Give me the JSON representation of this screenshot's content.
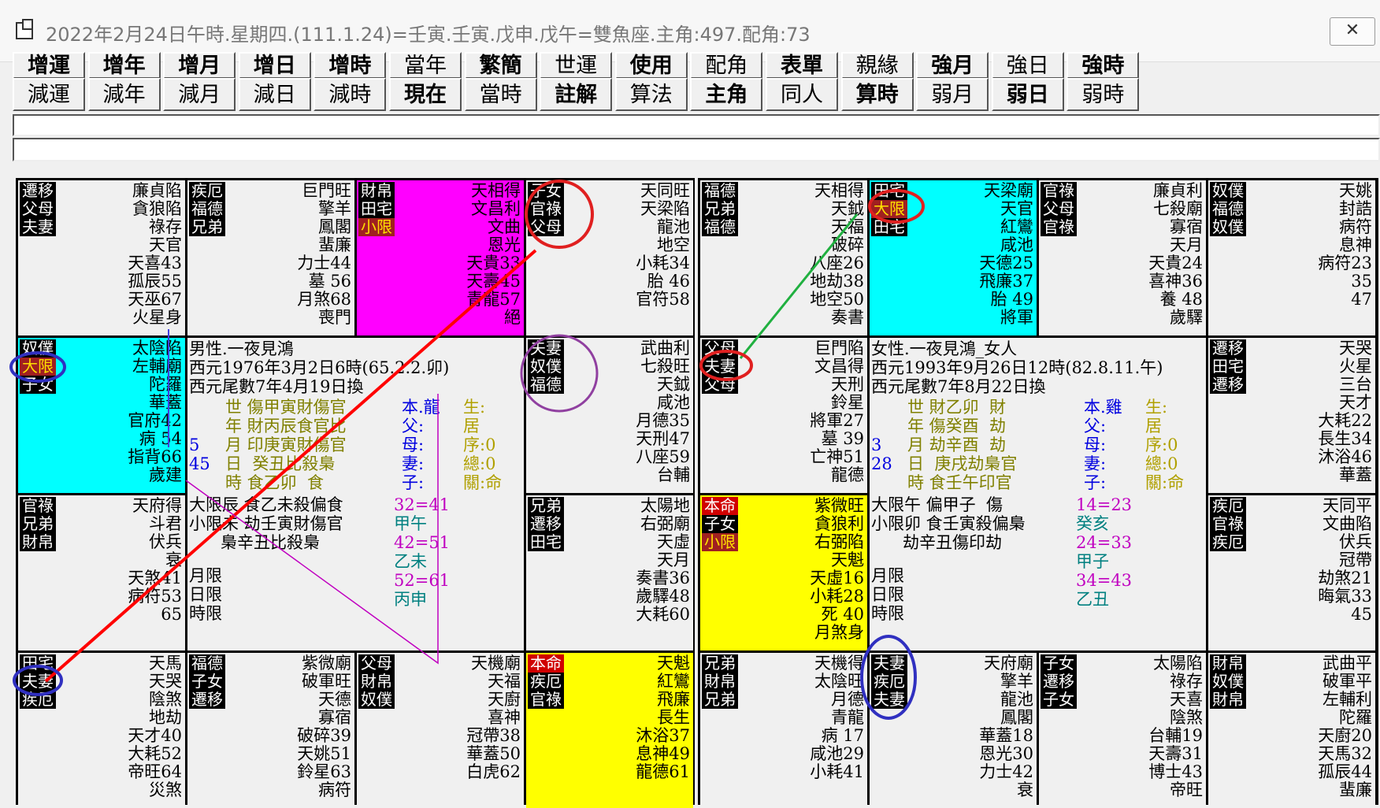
{
  "window": {
    "title": "2022年2月24日午時.星期四.(111.1.24)=壬寅.壬寅.戊申.戊午=雙魚座.主角:497.配角:73",
    "close_label": "✕"
  },
  "toolbar": {
    "row1": [
      "增運",
      "增年",
      "增月",
      "增日",
      "增時",
      "當年",
      "繁簡",
      "世運",
      "使用",
      "配角",
      "表單",
      "親緣",
      "強月",
      "強日",
      "強時"
    ],
    "row2": [
      "減運",
      "減年",
      "減月",
      "減日",
      "減時",
      "現在",
      "當時",
      "註解",
      "算法",
      "主角",
      "同人",
      "算時",
      "弱月",
      "弱日",
      "弱時"
    ]
  },
  "left_chart": {
    "cells": [
      {
        "palaces": [
          "遷移",
          "父母",
          "夫妻"
        ],
        "stars": [
          "廉貞陷",
          "貪狼陷",
          "祿存",
          "天官",
          "天喜43",
          "孤辰55",
          "天巫67",
          "火星身"
        ]
      },
      {
        "palaces": [
          "疾厄",
          "福德",
          "兄弟"
        ],
        "stars": [
          "巨門旺",
          "擎羊",
          "鳳閣",
          "蜚廉",
          "力士44",
          "墓 56",
          "月煞68",
          "喪門"
        ]
      },
      {
        "palaces": [
          "財帛",
          "田宅",
          "小限"
        ],
        "stars": [
          "天相得",
          "文昌利",
          "文曲",
          "恩光",
          "天貴33",
          "天壽45",
          "青龍57",
          "絕"
        ]
      },
      {
        "palaces": [
          "子女",
          "官祿",
          "父母"
        ],
        "stars": [
          "天同旺",
          "天梁陷",
          "龍池",
          "地空",
          "小耗34",
          "胎 46",
          "官符58"
        ]
      },
      {
        "palaces": [
          "奴僕",
          "大限",
          "子女"
        ],
        "stars": [
          "太陰陷",
          "左輔廟",
          "陀羅",
          "華蓋",
          "官府42",
          "病 54",
          "指背66",
          "歲建"
        ]
      },
      {
        "palaces": [
          "夫妻",
          "奴僕",
          "福德"
        ],
        "stars": [
          "武曲利",
          "七殺旺",
          "天鉞",
          "咸池",
          "月德35",
          "天刑47",
          "八座59",
          "台輔"
        ]
      },
      {
        "palaces": [
          "官祿",
          "兄弟",
          "財帛"
        ],
        "stars": [
          "天府得",
          "斗君",
          "伏兵",
          "衰",
          "天煞41",
          "病符53",
          "65"
        ]
      },
      {
        "palaces": [
          "兄弟",
          "遷移",
          "田宅"
        ],
        "stars": [
          "太陽地",
          "右弼廟",
          "天虛",
          "天月",
          "奏書36",
          "歲驛48",
          "大耗60"
        ]
      },
      {
        "palaces": [
          "田宅",
          "夫妻",
          "疾厄"
        ],
        "stars": [
          "天馬",
          "天哭",
          "陰煞",
          "地劫",
          "天才40",
          "大耗52",
          "帝旺64",
          "災煞"
        ]
      },
      {
        "palaces": [
          "福德",
          "子女",
          "遷移"
        ],
        "stars": [
          "紫微廟",
          "破軍旺",
          "天德",
          "寡宿",
          "破碎39",
          "天姚51",
          "鈴星63",
          "病符"
        ]
      },
      {
        "palaces": [
          "父母",
          "財帛",
          "奴僕"
        ],
        "stars": [
          "天機廟",
          "天福",
          "天廚",
          "喜神",
          "冠帶38",
          "華蓋50",
          "白虎62"
        ]
      },
      {
        "palaces": [
          "本命",
          "疾厄",
          "官祿"
        ],
        "stars": [
          "天魁",
          "紅鸞",
          "飛廉",
          "長生",
          "沐浴37",
          "息神49",
          "龍德61"
        ]
      }
    ],
    "center": {
      "line1": "男性.一夜見鴻",
      "line2": "西元1976年3月2日6時(65.2.2.卯)",
      "line3": "西元尾數7年4月19日換",
      "rows": [
        "世 傷甲寅財傷官",
        "年 財丙辰食官比",
        "月 印庚寅財傷官",
        "日  癸丑比殺梟",
        "時 食乙卯  食"
      ],
      "rel": [
        "本.龍",
        "父:",
        "母:",
        "妻:",
        "子:"
      ],
      "rel2": [
        "生:",
        "居",
        "序:0",
        "總:0",
        "關:命"
      ],
      "nums": [
        "5",
        "45"
      ],
      "daxian": [
        "大限辰 食乙未殺偏食",
        "小限未 劫壬寅財傷官",
        "      梟辛丑比殺梟"
      ],
      "months": [
        "月限",
        "日限",
        "時限"
      ],
      "ranges": [
        "32=41",
        "甲午",
        "42=51",
        "乙未",
        "52=61",
        "丙申"
      ]
    }
  },
  "right_chart": {
    "cells": [
      {
        "palaces": [
          "福德",
          "兄弟",
          "福德"
        ],
        "stars": [
          "天相得",
          "天鉞",
          "天福",
          "破碎",
          "八座26",
          "地劫38",
          "地空50",
          "奏書"
        ]
      },
      {
        "palaces": [
          "田宅",
          "大限",
          "田宅"
        ],
        "stars": [
          "天梁廟",
          "天官",
          "紅鸞",
          "咸池",
          "天德25",
          "飛廉37",
          "胎 49",
          "將軍"
        ]
      },
      {
        "palaces": [
          "官祿",
          "父母",
          "官祿"
        ],
        "stars": [
          "廉貞利",
          "七殺廟",
          "寡宿",
          "天月",
          "天貴24",
          "喜神36",
          "養 48",
          "歲驛"
        ]
      },
      {
        "palaces": [
          "奴僕",
          "福德",
          "奴僕"
        ],
        "stars": [
          "天姚",
          "封誥",
          "病符",
          "息神",
          "病符23",
          "35",
          "47"
        ]
      },
      {
        "palaces": [
          "父母",
          "夫妻",
          "父母"
        ],
        "stars": [
          "巨門陷",
          "文昌得",
          "天刑",
          "鈴星",
          "將軍27",
          "墓 39",
          "亡神51",
          "龍德"
        ]
      },
      {
        "palaces": [
          "遷移",
          "田宅",
          "遷移"
        ],
        "stars": [
          "天哭",
          "火星",
          "三台",
          "天才",
          "大耗22",
          "長生34",
          "沐浴46",
          "華蓋"
        ]
      },
      {
        "palaces": [
          "本命",
          "子女",
          "小限"
        ],
        "stars": [
          "紫微旺",
          "貪狼利",
          "右弼陷",
          "天魁",
          "天虛16",
          "小耗28",
          "死 40",
          "月煞身"
        ]
      },
      {
        "palaces": [
          "疾厄",
          "官祿",
          "疾厄"
        ],
        "stars": [
          "天同平",
          "文曲陷",
          "伏兵",
          "冠帶",
          "劫煞21",
          "晦氣33",
          "45"
        ]
      },
      {
        "palaces": [
          "兄弟",
          "財帛",
          "兄弟"
        ],
        "stars": [
          "天機得",
          "太陰旺",
          "月德",
          "青龍",
          "病 17",
          "咸池29",
          "小耗41"
        ]
      },
      {
        "palaces": [
          "夫妻",
          "疾厄",
          "夫妻"
        ],
        "stars": [
          "天府廟",
          "擎羊",
          "龍池",
          "鳳閣",
          "華蓋18",
          "恩光30",
          "力士42",
          "衰"
        ]
      },
      {
        "palaces": [
          "子女",
          "遷移",
          "子女"
        ],
        "stars": [
          "太陽陷",
          "祿存",
          "天喜",
          "陰煞",
          "台輔19",
          "天壽31",
          "博士43",
          "帝旺"
        ]
      },
      {
        "palaces": [
          "財帛",
          "奴僕",
          "財帛"
        ],
        "stars": [
          "武曲平",
          "破軍平",
          "左輔利",
          "陀羅",
          "天廚20",
          "天馬32",
          "孤辰44",
          "蜚廉"
        ]
      }
    ],
    "center": {
      "line1": "女性.一夜見鴻_女人",
      "line2": "西元1993年9月26日12時(82.8.11.午)",
      "line3": "西元尾數7年8月22日換",
      "rows": [
        "世 財乙卯  財",
        "年 傷癸酉  劫",
        "月 劫辛酉  劫",
        "日  庚戌劫梟官",
        "時 食壬午印官"
      ],
      "rel": [
        "本.雞",
        "父:",
        "母:",
        "妻:",
        "子:"
      ],
      "rel2": [
        "生:",
        "居",
        "序:0",
        "總:0",
        "關:命"
      ],
      "nums": [
        "3",
        "28"
      ],
      "daxian": [
        "大限午 偏甲子  傷",
        "小限卯 食壬寅殺偏梟",
        "      劫辛丑傷印劫"
      ],
      "months": [
        "月限",
        "日限",
        "時限"
      ],
      "ranges": [
        "14=23",
        "癸亥",
        "24=33",
        "甲子",
        "34=43",
        "乙丑"
      ]
    }
  },
  "colors": {
    "cyan": "#00ffff",
    "magenta": "#ff00ff",
    "yellow": "#ffff00",
    "red": "#ff0000",
    "blue": "#2020c0",
    "purple": "#9040a0",
    "green": "#20a040"
  }
}
